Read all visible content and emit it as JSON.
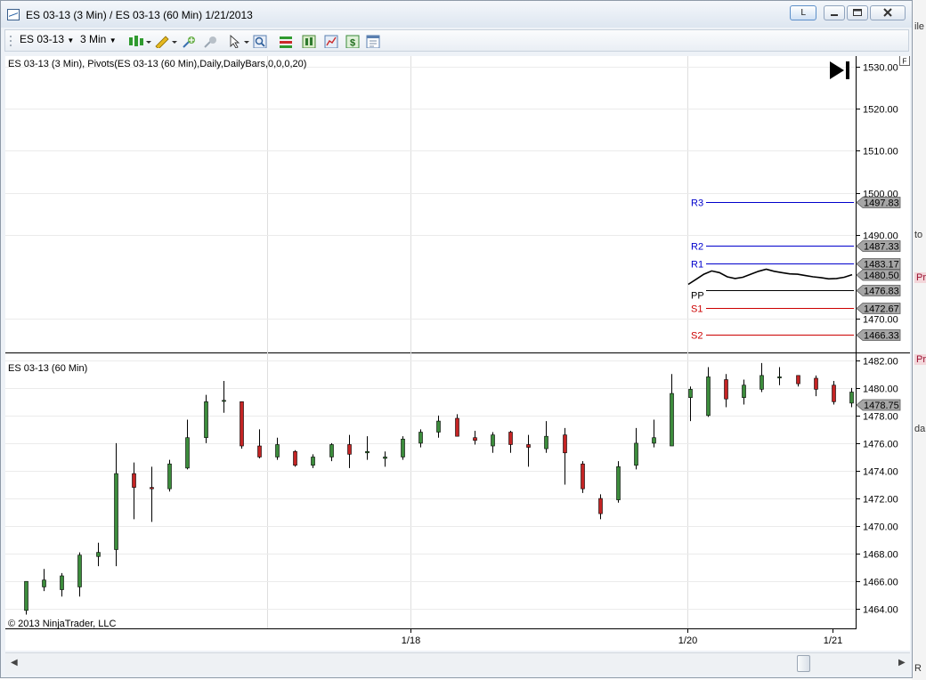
{
  "window": {
    "title": "ES 03-13 (3 Min) / ES 03-13 (60 Min)  1/21/2013",
    "link_button": "L"
  },
  "toolbar": {
    "instrument": "ES 03-13",
    "interval": "3 Min",
    "icons": [
      "bar-type-icon",
      "drawing-pencil-icon",
      "add-indicator-icon",
      "remove-indicator-icon",
      "cursor-icon",
      "zoom-icon",
      "strategy-icon",
      "chart-style-icon",
      "data-series-icon",
      "dollar-icon",
      "properties-icon"
    ]
  },
  "upper_panel": {
    "label": "ES 03-13 (3 Min),  Pivots(ES 03-13 (60 Min),Daily,DailyBars,0,0,0,20)",
    "y_ticks": [
      "1530.00",
      "1520.00",
      "1510.00",
      "1500.00",
      "1490.00",
      "1470.00"
    ],
    "ylim": [
      1462,
      1532.5
    ],
    "pivots": [
      {
        "name": "R3",
        "value": 1497.83,
        "label": "1497.83",
        "color": "#0000cc"
      },
      {
        "name": "R2",
        "value": 1487.33,
        "label": "1487.33",
        "color": "#0000cc"
      },
      {
        "name": "R1",
        "value": 1483.17,
        "label": "1483.17",
        "color": "#0000cc"
      },
      {
        "name": "PP",
        "value": 1476.83,
        "label": "1476.83",
        "color": "#000000"
      },
      {
        "name": "S1",
        "value": 1472.67,
        "label": "1472.67",
        "color": "#cc0000"
      },
      {
        "name": "S2",
        "value": 1466.33,
        "label": "1466.33",
        "color": "#cc0000"
      }
    ],
    "last_price": {
      "value": 1480.5,
      "label": "1480.50"
    },
    "price_line": [
      1478.2,
      1479.4,
      1480.6,
      1481.4,
      1481.0,
      1480.0,
      1479.6,
      1479.9,
      1480.6,
      1481.3,
      1481.8,
      1481.3,
      1481.0,
      1480.7,
      1480.6,
      1480.3,
      1480.0,
      1479.8,
      1479.5,
      1479.6,
      1479.9,
      1480.5
    ]
  },
  "lower_panel": {
    "label": "ES 03-13 (60 Min)",
    "copyright": "© 2013 NinjaTrader, LLC",
    "y_ticks": [
      "1482.00",
      "1480.00",
      "1478.00",
      "1476.00",
      "1474.00",
      "1472.00",
      "1470.00",
      "1468.00",
      "1466.00",
      "1464.00"
    ],
    "ylim": [
      1462.6,
      1482.5
    ],
    "last_price": {
      "value": 1478.75,
      "label": "1478.75"
    }
  },
  "x_axis": {
    "ticks": [
      {
        "label": "1/18"
      },
      {
        "label": "1/20"
      },
      {
        "label": "1/21"
      }
    ]
  },
  "chart_data": {
    "type": "candlestick",
    "series": [
      {
        "o": 1463.9,
        "h": 1466.0,
        "l": 1463.6,
        "c": 1466.0
      },
      {
        "o": 1465.6,
        "h": 1466.9,
        "l": 1465.3,
        "c": 1466.1
      },
      {
        "o": 1465.4,
        "h": 1466.6,
        "l": 1464.9,
        "c": 1466.4
      },
      {
        "o": 1465.6,
        "h": 1468.1,
        "l": 1464.9,
        "c": 1467.9
      },
      {
        "o": 1467.8,
        "h": 1468.8,
        "l": 1467.1,
        "c": 1468.1
      },
      {
        "o": 1468.3,
        "h": 1476.0,
        "l": 1467.1,
        "c": 1473.8
      },
      {
        "o": 1473.8,
        "h": 1474.6,
        "l": 1470.5,
        "c": 1472.8
      },
      {
        "o": 1472.8,
        "h": 1474.3,
        "l": 1470.3,
        "c": 1472.7
      },
      {
        "o": 1472.7,
        "h": 1474.8,
        "l": 1472.5,
        "c": 1474.5
      },
      {
        "o": 1474.2,
        "h": 1477.7,
        "l": 1474.1,
        "c": 1476.4
      },
      {
        "o": 1476.4,
        "h": 1479.5,
        "l": 1476.0,
        "c": 1479.0
      },
      {
        "o": 1479.1,
        "h": 1480.5,
        "l": 1478.2,
        "c": 1479.1
      },
      {
        "o": 1479.0,
        "h": 1479.0,
        "l": 1475.6,
        "c": 1475.8
      },
      {
        "o": 1475.8,
        "h": 1477.0,
        "l": 1474.9,
        "c": 1475.0
      },
      {
        "o": 1475.0,
        "h": 1476.4,
        "l": 1474.8,
        "c": 1475.9
      },
      {
        "o": 1475.4,
        "h": 1475.5,
        "l": 1474.3,
        "c": 1474.4
      },
      {
        "o": 1474.4,
        "h": 1475.2,
        "l": 1474.2,
        "c": 1475.0
      },
      {
        "o": 1475.0,
        "h": 1476.0,
        "l": 1474.7,
        "c": 1475.9
      },
      {
        "o": 1475.9,
        "h": 1476.6,
        "l": 1474.2,
        "c": 1475.2
      },
      {
        "o": 1475.3,
        "h": 1476.5,
        "l": 1474.8,
        "c": 1475.4
      },
      {
        "o": 1474.9,
        "h": 1475.4,
        "l": 1474.3,
        "c": 1475.0
      },
      {
        "o": 1475.0,
        "h": 1476.5,
        "l": 1474.8,
        "c": 1476.3
      },
      {
        "o": 1476.0,
        "h": 1477.0,
        "l": 1475.7,
        "c": 1476.8
      },
      {
        "o": 1476.8,
        "h": 1478.0,
        "l": 1476.4,
        "c": 1477.6
      },
      {
        "o": 1477.8,
        "h": 1478.1,
        "l": 1476.5,
        "c": 1476.5
      },
      {
        "o": 1476.4,
        "h": 1476.9,
        "l": 1475.9,
        "c": 1476.2
      },
      {
        "o": 1475.8,
        "h": 1476.8,
        "l": 1475.3,
        "c": 1476.6
      },
      {
        "o": 1476.8,
        "h": 1476.9,
        "l": 1475.3,
        "c": 1475.9
      },
      {
        "o": 1475.9,
        "h": 1476.6,
        "l": 1474.3,
        "c": 1475.7
      },
      {
        "o": 1475.6,
        "h": 1477.6,
        "l": 1475.3,
        "c": 1476.5
      },
      {
        "o": 1476.6,
        "h": 1477.1,
        "l": 1473.0,
        "c": 1475.3
      },
      {
        "o": 1474.5,
        "h": 1474.7,
        "l": 1472.4,
        "c": 1472.7
      },
      {
        "o": 1472.0,
        "h": 1472.3,
        "l": 1470.5,
        "c": 1470.9
      },
      {
        "o": 1471.9,
        "h": 1474.7,
        "l": 1471.7,
        "c": 1474.3
      },
      {
        "o": 1474.4,
        "h": 1477.1,
        "l": 1474.1,
        "c": 1476.0
      },
      {
        "o": 1476.0,
        "h": 1477.7,
        "l": 1475.7,
        "c": 1476.4
      },
      {
        "o": 1475.8,
        "h": 1481.0,
        "l": 1475.8,
        "c": 1479.6
      },
      {
        "o": 1479.3,
        "h": 1480.1,
        "l": 1477.6,
        "c": 1479.9
      },
      {
        "o": 1478.0,
        "h": 1481.5,
        "l": 1477.9,
        "c": 1480.8
      },
      {
        "o": 1480.6,
        "h": 1481.0,
        "l": 1478.6,
        "c": 1479.2
      },
      {
        "o": 1479.3,
        "h": 1480.6,
        "l": 1478.8,
        "c": 1480.2
      },
      {
        "o": 1479.9,
        "h": 1481.8,
        "l": 1479.7,
        "c": 1480.9
      },
      {
        "o": 1480.8,
        "h": 1481.5,
        "l": 1480.2,
        "c": 1480.8
      },
      {
        "o": 1480.9,
        "h": 1480.9,
        "l": 1480.1,
        "c": 1480.3
      },
      {
        "o": 1480.7,
        "h": 1480.9,
        "l": 1479.4,
        "c": 1479.9
      },
      {
        "o": 1480.2,
        "h": 1480.5,
        "l": 1478.8,
        "c": 1479.0
      },
      {
        "o": 1478.9,
        "h": 1480.0,
        "l": 1478.6,
        "c": 1479.7
      }
    ]
  }
}
